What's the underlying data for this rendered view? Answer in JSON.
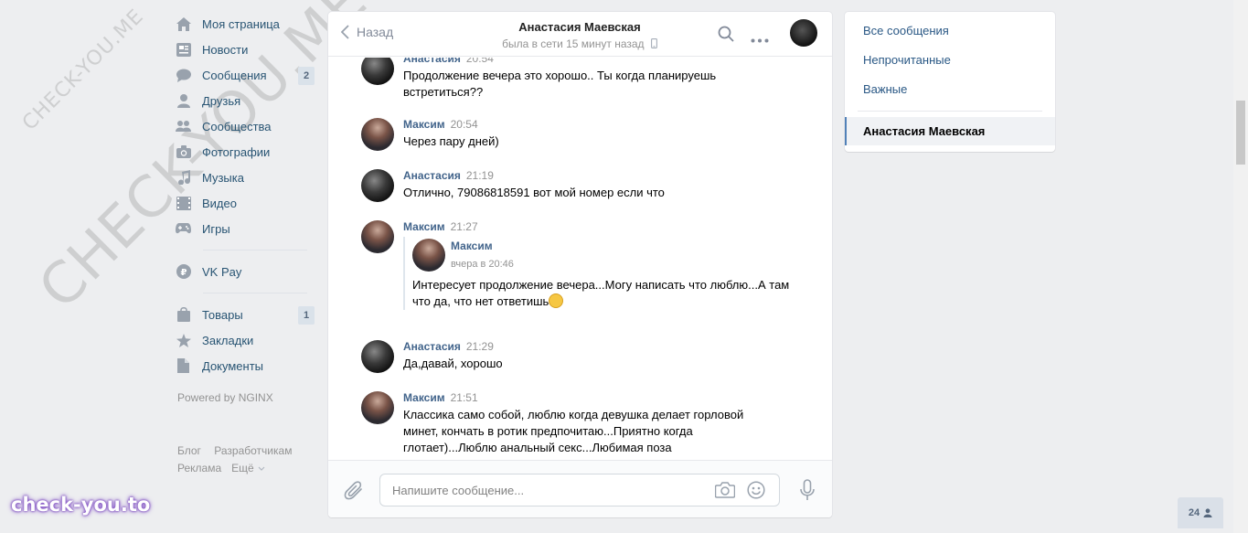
{
  "watermark": {
    "small": "CHECK-YOU.ME",
    "large": "CHECK-YOU.ME",
    "brand": "check-you.to"
  },
  "nav": {
    "items": [
      {
        "label": "Моя страница",
        "icon": "home-icon"
      },
      {
        "label": "Новости",
        "icon": "news-icon"
      },
      {
        "label": "Сообщения",
        "icon": "messages-icon",
        "count": "2"
      },
      {
        "label": "Друзья",
        "icon": "friend-icon"
      },
      {
        "label": "Сообщества",
        "icon": "groups-icon"
      },
      {
        "label": "Фотографии",
        "icon": "camera-icon"
      },
      {
        "label": "Музыка",
        "icon": "music-icon"
      },
      {
        "label": "Видео",
        "icon": "video-icon"
      },
      {
        "label": "Игры",
        "icon": "gamepad-icon"
      }
    ],
    "vkpay": {
      "label": "VK Pay",
      "icon": "vkpay-icon"
    },
    "extra": [
      {
        "label": "Товары",
        "icon": "bag-icon",
        "count": "1"
      },
      {
        "label": "Закладки",
        "icon": "star-icon"
      },
      {
        "label": "Документы",
        "icon": "document-icon"
      }
    ],
    "powered": "Powered by NGINX",
    "footer": {
      "blog": "Блог",
      "dev": "Разработчикам",
      "ads": "Реклама",
      "more": "Ещё"
    }
  },
  "chat": {
    "back_label": "Назад",
    "peer_name": "Анастасия Маевская",
    "peer_status": "была в сети 15 минут назад",
    "messages": [
      {
        "author": "Анастасия",
        "time": "20:54",
        "text": "Продолжение вечера это хорошо.. Ты когда планируешь встретиться??"
      },
      {
        "author": "Максим",
        "time": "20:54",
        "text": "Через пару дней)"
      },
      {
        "author": "Анастасия",
        "time": "21:19",
        "text": "Отлично, 79086818591 вот мой номер если что"
      },
      {
        "author": "Максим",
        "time": "21:27",
        "text": "",
        "forward": {
          "author": "Максим",
          "time": "вчера в 20:46",
          "text": "Интересует продолжение вечера...Могу написать что люблю...А там что да, что нет ответишь"
        }
      },
      {
        "author": "Анастасия",
        "time": "21:29",
        "text": "Да,давай, хорошо"
      },
      {
        "author": "Максим",
        "time": "21:51",
        "text": "Классика само собой, люблю когда девушка делает горловой минет, кончать в ротик предпочитаю...Приятно когда глотает)...Люблю анальный секс...Любимая поза"
      }
    ],
    "composer": {
      "placeholder": "Напишите сообщение..."
    }
  },
  "filters": {
    "items": [
      "Все сообщения",
      "Непрочитанные",
      "Важные"
    ],
    "active": "Анастасия Маевская"
  },
  "online_count": "24",
  "colors": {
    "link": "#2a5885",
    "author": "#42648b",
    "background": "#edeef0",
    "icon": "#99a2ad"
  }
}
